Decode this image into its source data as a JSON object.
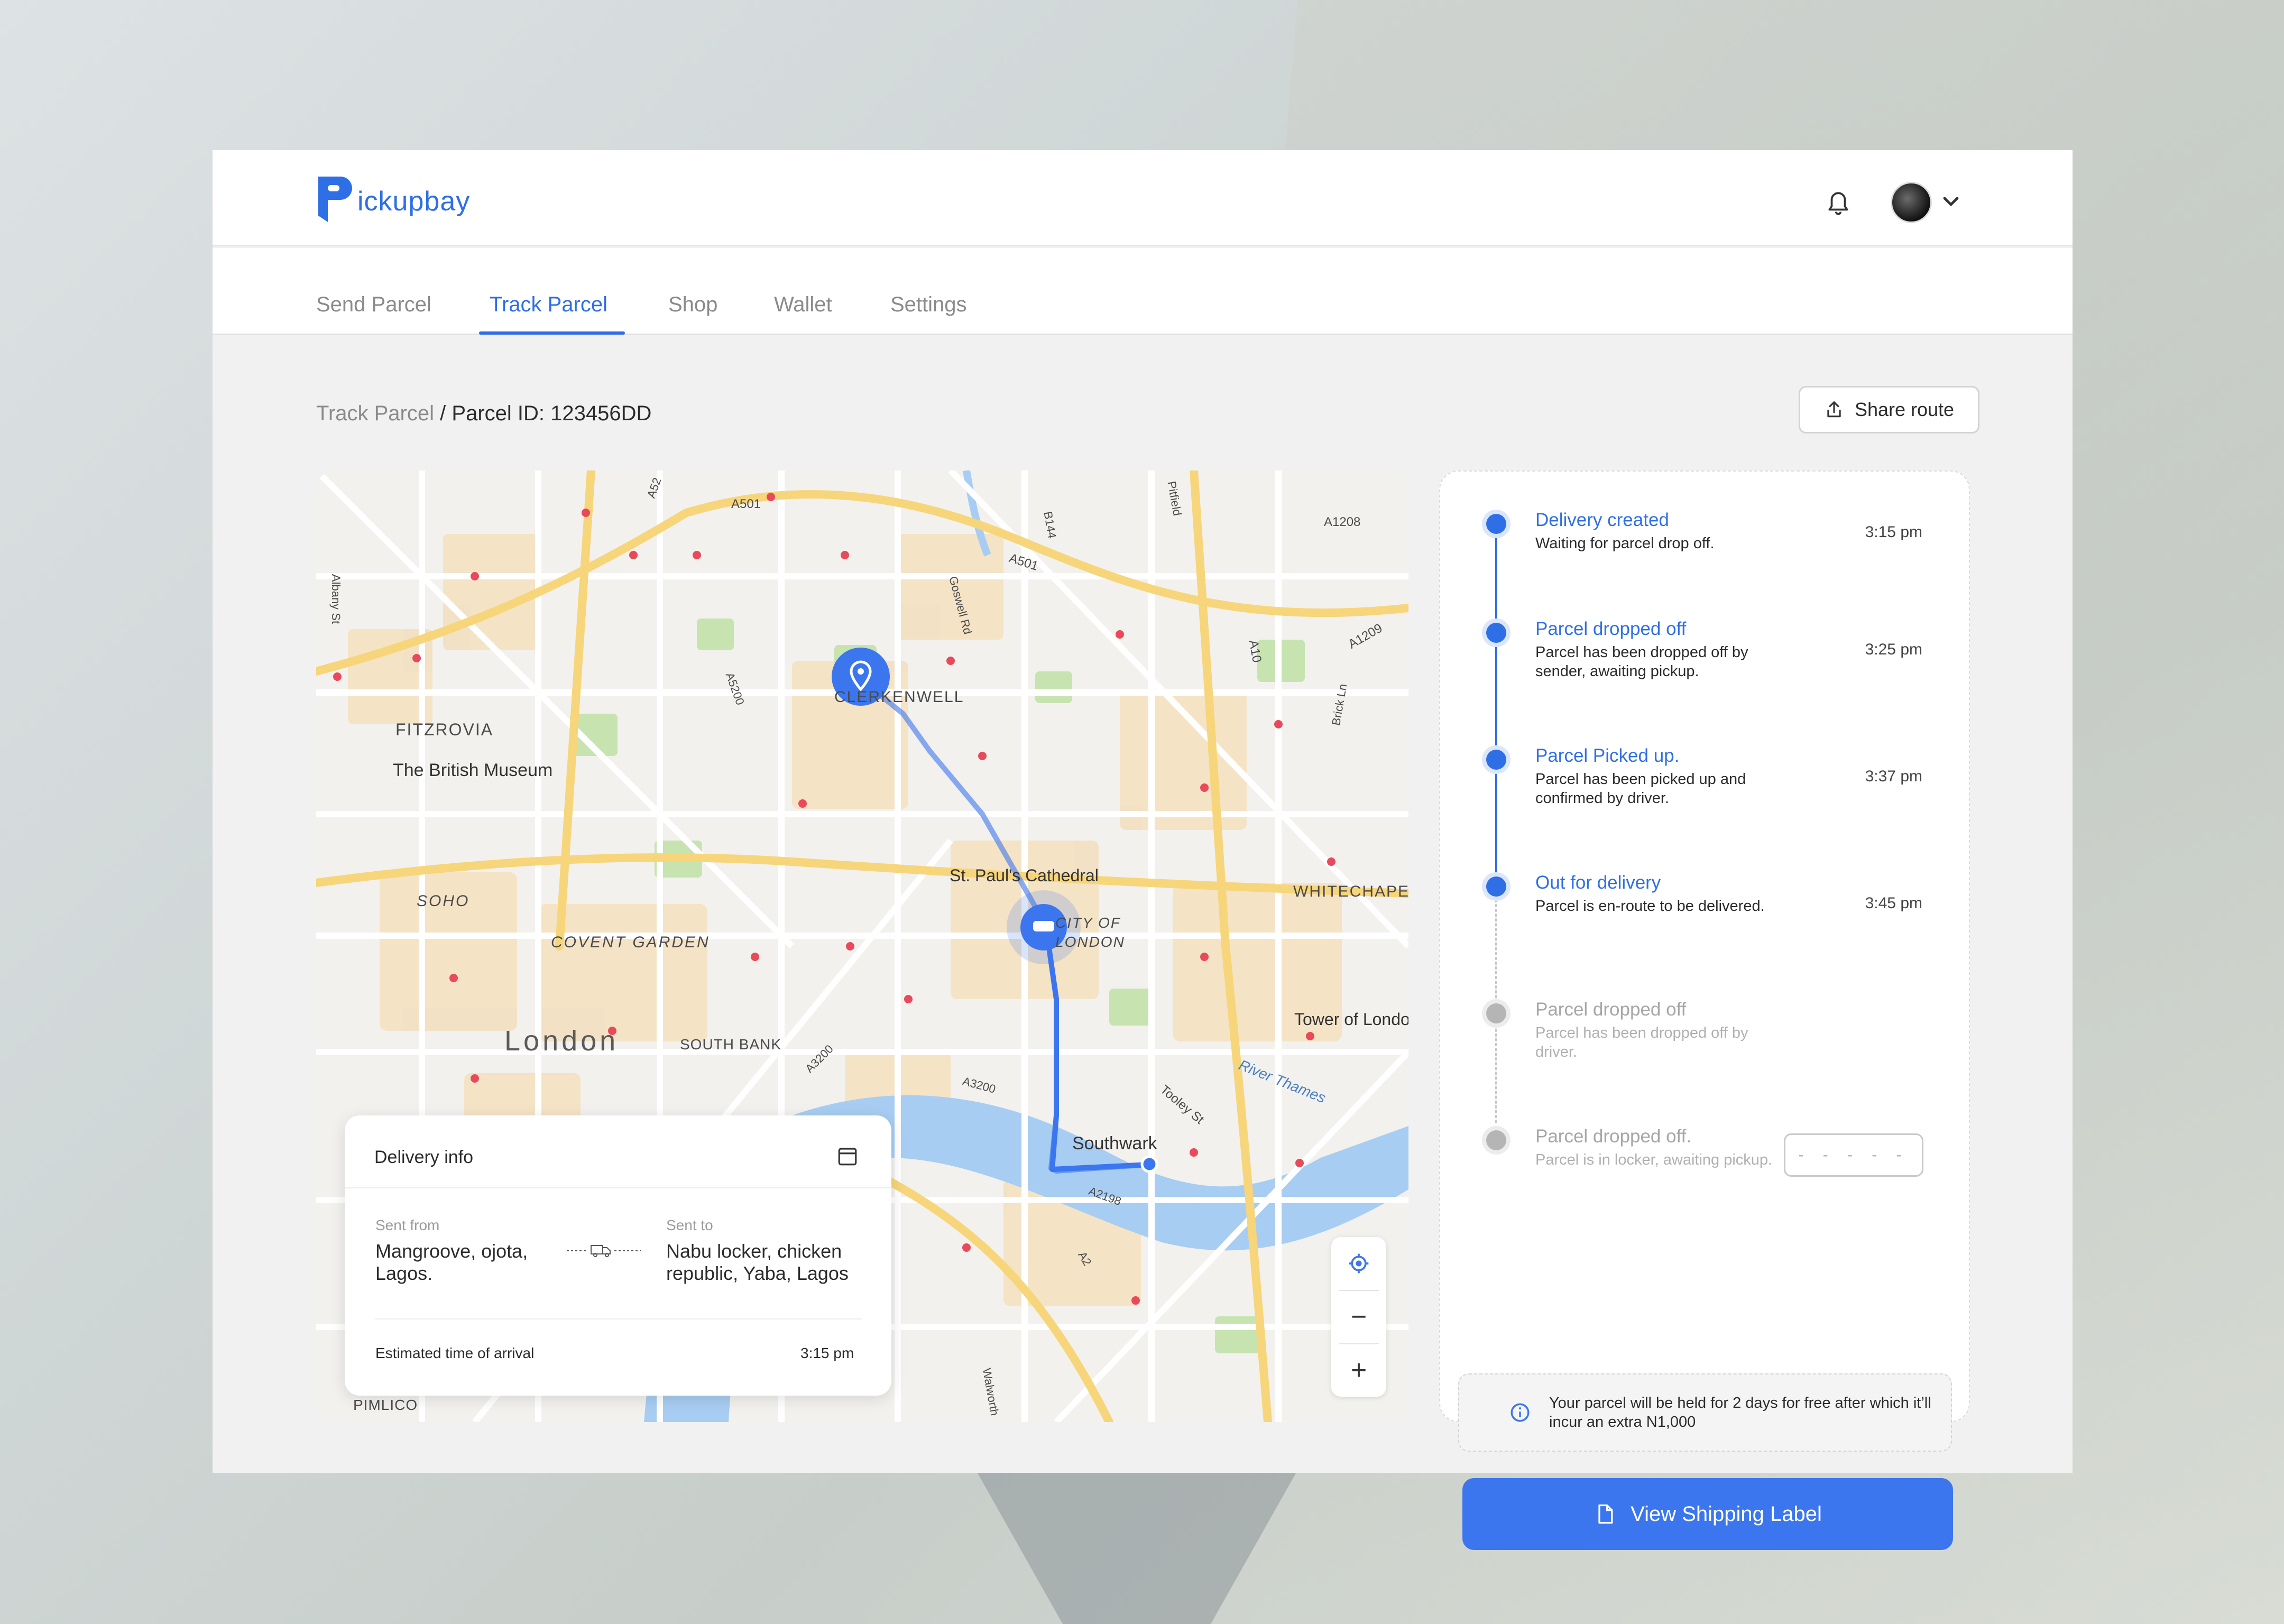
{
  "app": {
    "logo_text": "ickupbay",
    "logo_letter": "P"
  },
  "nav": {
    "items": [
      {
        "label": "Send Parcel"
      },
      {
        "label": "Track Parcel",
        "active": true
      },
      {
        "label": "Shop"
      },
      {
        "label": "Wallet"
      },
      {
        "label": "Settings"
      }
    ]
  },
  "breadcrumb": {
    "parent": "Track Parcel",
    "separator": "/",
    "current": "Parcel ID: 123456DD"
  },
  "share_button": {
    "label": "Share route",
    "icon": "share-icon"
  },
  "map": {
    "labels": {
      "fitzrovia": "FITZROVIA",
      "british_museum": "The British Museum",
      "soho": "SOHO",
      "covent_garden": "COVENT GARDEN",
      "london": "London",
      "south_bank": "SOUTH BANK",
      "clerkenwell": "CLERKENWELL",
      "st_pauls": "St. Paul's Cathedral",
      "city_of_london": "CITY OF LONDON",
      "whitechapel": "WHITECHAPEL",
      "tower_of_london": "Tower of London",
      "river_thames": "River Thames",
      "southwark": "Southwark",
      "tooley_st": "Tooley St",
      "pimlico": "PIMLICO",
      "a501": "A501",
      "a501b": "A501",
      "b144": "B144",
      "goswell_rd": "Goswell Rd",
      "a1208": "A1208",
      "a1209": "A1209",
      "a10": "A10",
      "a5200": "A5200",
      "a3200": "A3200",
      "a3200b": "A3200",
      "a2198": "A2198",
      "a2": "A2",
      "albany_st": "Albany St",
      "brick_ln": "Brick Ln",
      "pitfield": "Pitfield",
      "a52": "A52",
      "walworth": "Walworth"
    },
    "colors": {
      "route": "#3b76ee",
      "water": "#a7cdf2",
      "road_major": "#f7d57a",
      "park": "#c7e4b0",
      "urban": "#f4e1c3"
    }
  },
  "delivery_info": {
    "title": "Delivery info",
    "sent_from_label": "Sent from",
    "sent_from_value": "Mangroove, ojota, Lagos.",
    "sent_to_label": "Sent to",
    "sent_to_value": "Nabu locker, chicken republic, Yaba, Lagos",
    "eta_label": "Estimated time of arrival",
    "eta_value": "3:15 pm"
  },
  "map_controls": {
    "locate": "target-icon",
    "zoom_out": "−",
    "zoom_in": "+"
  },
  "timeline": {
    "steps": [
      {
        "title": "Delivery created",
        "desc": "Waiting for parcel drop off.",
        "time": "3:15 pm",
        "done": true
      },
      {
        "title": "Parcel dropped off",
        "desc": "Parcel has been dropped off by sender, awaiting pickup.",
        "time": "3:25 pm",
        "done": true
      },
      {
        "title": "Parcel Picked up.",
        "desc": "Parcel has been picked up and confirmed by driver.",
        "time": "3:37 pm",
        "done": true
      },
      {
        "title": "Out for delivery",
        "desc": "Parcel is en-route to be delivered.",
        "time": "3:45 pm",
        "done": true
      },
      {
        "title": "Parcel dropped off",
        "desc": "Parcel has been dropped off by driver.",
        "time": "",
        "done": false
      },
      {
        "title": "Parcel dropped off.",
        "desc": "Parcel is in locker, awaiting pickup.",
        "time": "",
        "done": false
      }
    ],
    "code_placeholder": "- - - - -"
  },
  "notice": {
    "text": "Your parcel will be held for 2 days for free after which it’ll incur an extra N1,000"
  },
  "shipping_button": {
    "label": "View Shipping Label"
  }
}
